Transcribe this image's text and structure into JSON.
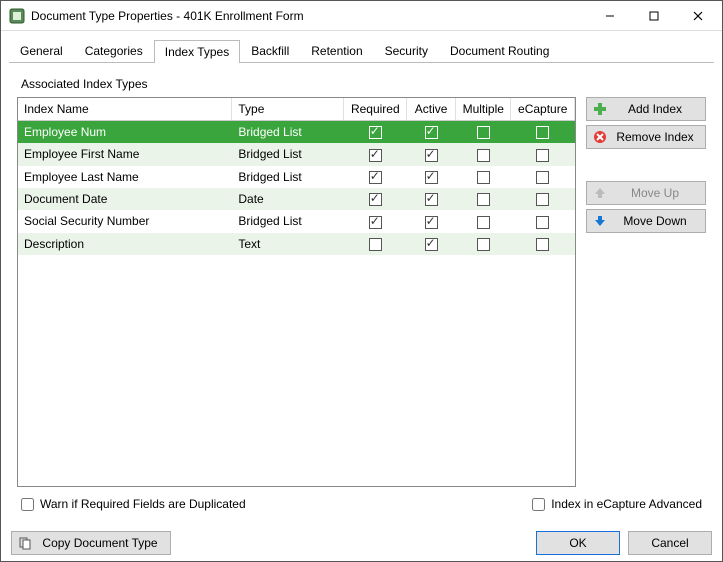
{
  "title": "Document Type Properties  - 401K Enrollment Form",
  "tabs": [
    "General",
    "Categories",
    "Index Types",
    "Backfill",
    "Retention",
    "Security",
    "Document Routing"
  ],
  "active_tab": 2,
  "section_label": "Associated Index Types",
  "columns": {
    "name": "Index Name",
    "type": "Type",
    "required": "Required",
    "active": "Active",
    "multiple": "Multiple",
    "ecapture": "eCapture"
  },
  "rows": [
    {
      "name": "Employee Num",
      "type": "Bridged List",
      "required": true,
      "active": true,
      "multiple": false,
      "ecapture": false,
      "selected": true
    },
    {
      "name": "Employee First Name",
      "type": "Bridged List",
      "required": true,
      "active": true,
      "multiple": false,
      "ecapture": false,
      "selected": false
    },
    {
      "name": "Employee Last Name",
      "type": "Bridged List",
      "required": true,
      "active": true,
      "multiple": false,
      "ecapture": false,
      "selected": false
    },
    {
      "name": "Document Date",
      "type": "Date",
      "required": true,
      "active": true,
      "multiple": false,
      "ecapture": false,
      "selected": false
    },
    {
      "name": "Social Security Number",
      "type": "Bridged List",
      "required": true,
      "active": true,
      "multiple": false,
      "ecapture": false,
      "selected": false
    },
    {
      "name": "Description",
      "type": "Text",
      "required": false,
      "active": true,
      "multiple": false,
      "ecapture": false,
      "selected": false
    }
  ],
  "side_buttons": {
    "add": "Add Index",
    "remove": "Remove Index",
    "up": "Move Up",
    "down": "Move Down"
  },
  "bottom_checks": {
    "warn": "Warn if Required Fields are Duplicated",
    "ecapture_adv": "Index in eCapture Advanced"
  },
  "footer": {
    "copy": "Copy Document Type",
    "ok": "OK",
    "cancel": "Cancel"
  }
}
